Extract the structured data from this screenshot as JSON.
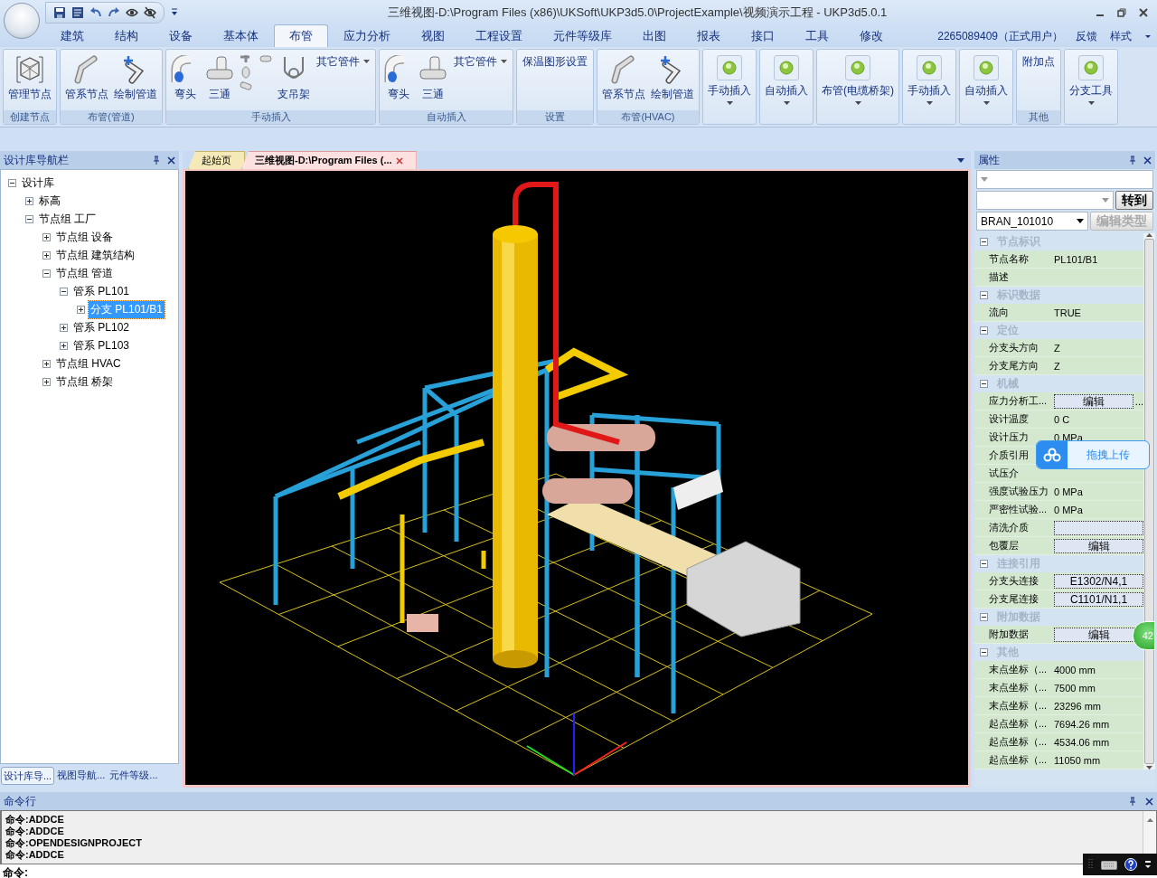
{
  "window": {
    "title": "三维视图-D:\\Program Files (x86)\\UKSoft\\UKP3d5.0\\ProjectExample\\视频演示工程 - UKP3d5.0.1"
  },
  "menu_tabs": [
    {
      "label": "建筑",
      "selected": false
    },
    {
      "label": "结构",
      "selected": false
    },
    {
      "label": "设备",
      "selected": false
    },
    {
      "label": "基本体",
      "selected": false
    },
    {
      "label": "布管",
      "selected": true
    },
    {
      "label": "应力分析",
      "selected": false
    },
    {
      "label": "视图",
      "selected": false
    },
    {
      "label": "工程设置",
      "selected": false
    },
    {
      "label": "元件等级库",
      "selected": false
    },
    {
      "label": "出图",
      "selected": false
    },
    {
      "label": "报表",
      "selected": false
    },
    {
      "label": "接口",
      "selected": false
    },
    {
      "label": "工具",
      "selected": false
    },
    {
      "label": "修改",
      "selected": false
    }
  ],
  "account": {
    "user": "2265089409（正式用户）",
    "links": [
      "反馈",
      "样式"
    ]
  },
  "ribbon_groups": [
    {
      "title": "创建节点",
      "items": [
        {
          "kind": "box",
          "label": "管理节点"
        }
      ]
    },
    {
      "title": "布管(管道)",
      "items": [
        {
          "kind": "pipe-node",
          "label": "管系节点"
        },
        {
          "kind": "draw-pipe",
          "label": "绘制管道"
        }
      ]
    },
    {
      "title": "手动插入",
      "items": [
        {
          "kind": "elbow",
          "label": "弯头"
        },
        {
          "kind": "tee",
          "label": "三通"
        },
        {
          "kind": "fittings"
        },
        {
          "kind": "support",
          "label": "支吊架"
        },
        {
          "kind": "menu",
          "label": "其它管件"
        }
      ]
    },
    {
      "title": "自动插入",
      "items": [
        {
          "kind": "elbow",
          "label": "弯头"
        },
        {
          "kind": "tee",
          "label": "三通"
        },
        {
          "kind": "menu",
          "label": "其它管件"
        }
      ]
    },
    {
      "title": "设置",
      "items": [
        {
          "kind": "text",
          "label": "保温图形设置"
        }
      ]
    },
    {
      "title": "布管(HVAC)",
      "items": [
        {
          "kind": "pipe-node",
          "label": "管系节点"
        },
        {
          "kind": "draw-pipe",
          "label": "绘制管道"
        }
      ]
    },
    {
      "items": [
        {
          "kind": "led",
          "label": "手动插入"
        }
      ]
    },
    {
      "items": [
        {
          "kind": "led",
          "label": "自动插入"
        }
      ]
    },
    {
      "items": [
        {
          "kind": "led",
          "label": "布管(电缆桥架)"
        }
      ]
    },
    {
      "items": [
        {
          "kind": "led",
          "label": "手动插入"
        }
      ]
    },
    {
      "items": [
        {
          "kind": "led",
          "label": "自动插入"
        }
      ]
    },
    {
      "title": "其他",
      "items": [
        {
          "kind": "text",
          "label": "附加点"
        }
      ]
    },
    {
      "items": [
        {
          "kind": "led",
          "label": "分支工具"
        }
      ]
    }
  ],
  "nav_panel": {
    "title": "设计库导航栏",
    "tree": [
      {
        "label": "设计库",
        "expanded": true,
        "selected": false,
        "children": [
          {
            "label": "标高",
            "expanded": false,
            "selected": false
          },
          {
            "label": "节点组 工厂",
            "expanded": true,
            "selected": false,
            "children": [
              {
                "label": "节点组 设备",
                "expanded": false,
                "selected": false
              },
              {
                "label": "节点组 建筑结构",
                "expanded": false,
                "selected": false
              },
              {
                "label": "节点组 管道",
                "expanded": true,
                "selected": false,
                "children": [
                  {
                    "label": "管系 PL101",
                    "expanded": true,
                    "selected": false,
                    "children": [
                      {
                        "label": "分支 PL101/B1",
                        "expanded": false,
                        "selected": true
                      }
                    ]
                  },
                  {
                    "label": "管系 PL102",
                    "expanded": false,
                    "selected": false
                  },
                  {
                    "label": "管系 PL103",
                    "expanded": false,
                    "selected": false
                  }
                ]
              },
              {
                "label": "节点组 HVAC",
                "expanded": false,
                "selected": false
              },
              {
                "label": "节点组 桥架",
                "expanded": false,
                "selected": false
              }
            ]
          }
        ]
      }
    ],
    "tabs": [
      {
        "label": "设计库导...",
        "selected": true
      },
      {
        "label": "视图导航...",
        "selected": false
      },
      {
        "label": "元件等级...",
        "selected": false
      }
    ]
  },
  "doc_tabs": [
    {
      "label": "起始页",
      "selected": false
    },
    {
      "label": "三维视图-D:\\Program Files (...",
      "selected": true
    }
  ],
  "properties": {
    "title": "属性",
    "goto_button": "转到",
    "type_combo": "BRAN_101010",
    "edit_type_button": "编辑类型",
    "sections": [
      {
        "title": "节点标识",
        "expanded": true,
        "rows": [
          {
            "name": "节点名称",
            "value": "PL101/B1",
            "kind": "text"
          },
          {
            "name": "描述",
            "value": "",
            "kind": "text"
          }
        ]
      },
      {
        "title": "标识数据",
        "expanded": true,
        "rows": [
          {
            "name": "流向",
            "value": "TRUE",
            "kind": "text"
          }
        ]
      },
      {
        "title": "定位",
        "expanded": true,
        "rows": [
          {
            "name": "分支头方向",
            "value": "Z",
            "kind": "text"
          },
          {
            "name": "分支尾方向",
            "value": "Z",
            "kind": "text"
          }
        ]
      },
      {
        "title": "机械",
        "expanded": true,
        "rows": [
          {
            "name": "应力分析工...",
            "value": "编辑",
            "kind": "button-more",
            "more": "..."
          },
          {
            "name": "设计温度",
            "value": "0 C",
            "kind": "text"
          },
          {
            "name": "设计压力",
            "value": "0 MPa",
            "kind": "text"
          },
          {
            "name": "介质引用",
            "value": "",
            "kind": "text"
          },
          {
            "name": "试压介",
            "value": "",
            "kind": "text"
          },
          {
            "name": "强度试验压力",
            "value": "0 MPa",
            "kind": "text"
          },
          {
            "name": "严密性试验...",
            "value": "0 MPa",
            "kind": "text"
          },
          {
            "name": "清洗介质",
            "value": "",
            "kind": "field"
          },
          {
            "name": "包覆层",
            "value": "编辑",
            "kind": "button"
          }
        ]
      },
      {
        "title": "连接引用",
        "expanded": true,
        "rows": [
          {
            "name": "分支头连接",
            "value": "E1302/N4,1",
            "kind": "button"
          },
          {
            "name": "分支尾连接",
            "value": "C1101/N1,1",
            "kind": "button"
          }
        ]
      },
      {
        "title": "附加数据",
        "expanded": true,
        "rows": [
          {
            "name": "附加数据",
            "value": "编辑",
            "kind": "button"
          }
        ]
      },
      {
        "title": "其他",
        "expanded": true,
        "rows": [
          {
            "name": "末点坐标（...",
            "value": "4000 mm",
            "kind": "text"
          },
          {
            "name": "末点坐标（...",
            "value": "7500 mm",
            "kind": "text"
          },
          {
            "name": "末点坐标（...",
            "value": "23296 mm",
            "kind": "text"
          },
          {
            "name": "起点坐标（...",
            "value": "7694.26 mm",
            "kind": "text"
          },
          {
            "name": "起点坐标（...",
            "value": "4534.06 mm",
            "kind": "text"
          },
          {
            "name": "起点坐标（...",
            "value": "11050 mm",
            "kind": "text"
          }
        ]
      }
    ]
  },
  "upload_popup": {
    "label": "拖拽上传"
  },
  "side_badge": "42",
  "command_panel": {
    "title": "命令行",
    "log": [
      "命令:ADDCE",
      "命令:ADDCE",
      "命令:OPENDESIGNPROJECT",
      "命令:ADDCE"
    ],
    "prompt": "命令:"
  }
}
